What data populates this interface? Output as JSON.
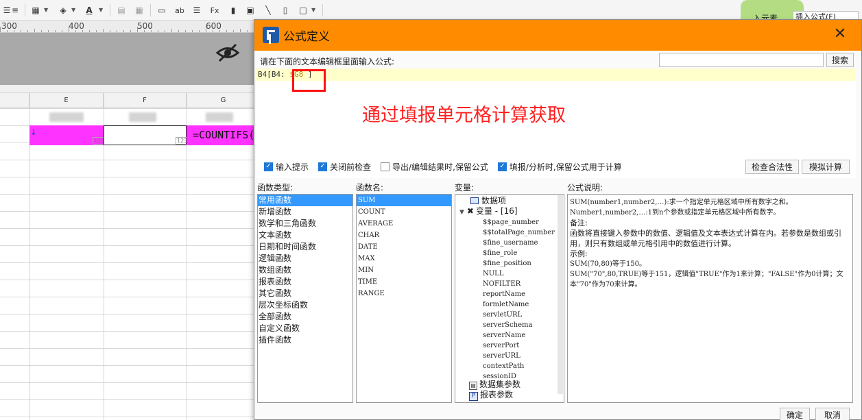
{
  "sheet": {
    "ruler_marks": [
      "300",
      "400",
      "500",
      "600"
    ],
    "columns": [
      "E",
      "F",
      "G"
    ],
    "cell_formula": "=COUNTIFS(",
    "cell_arrow": "↓",
    "cell_badge": "123"
  },
  "topbar": {
    "insert_element": "入元素",
    "insert_formula": "插入公式(F)"
  },
  "dialog": {
    "title": "公式定义",
    "close": "✕",
    "hint": "请在下面的文本编辑框里面输入公式:",
    "search_placeholder": "",
    "search_button": "搜索",
    "formula_prefix": "B4[B4: ",
    "formula_ref": "$G8",
    "formula_suffix": " ]",
    "annotation": "通过填报单元格计算获取",
    "options": [
      {
        "label": "输入提示",
        "checked": true
      },
      {
        "label": "关闭前检查",
        "checked": true
      },
      {
        "label": "导出/编辑结果时,保留公式",
        "checked": false
      },
      {
        "label": "填报/分析时,保留公式用于计算",
        "checked": true
      }
    ],
    "validate_button": "检查合法性",
    "simulate_button": "模拟计算",
    "function_type_label": "函数类型:",
    "function_name_label": "函数名:",
    "variable_label": "变量:",
    "description_label": "公式说明:",
    "function_types": [
      "常用函数",
      "新增函数",
      "数学和三角函数",
      "文本函数",
      "日期和时间函数",
      "逻辑函数",
      "数组函数",
      "报表函数",
      "其它函数",
      "层次坐标函数",
      "全部函数",
      "自定义函数",
      "插件函数"
    ],
    "function_names": [
      "SUM",
      "COUNT",
      "AVERAGE",
      "CHAR",
      "DATE",
      "MAX",
      "MIN",
      "TIME",
      "RANGE"
    ],
    "variables": {
      "data_items": "数据项",
      "variables_node": "变量 - [16]",
      "items": [
        "$$page_number",
        "$$totalPage_number",
        "$fine_username",
        "$fine_role",
        "$fine_position",
        "NULL",
        "NOFILTER",
        "reportName",
        "formletName",
        "servletURL",
        "serverSchema",
        "serverName",
        "serverPort",
        "serverURL",
        "contextPath",
        "sessionID"
      ],
      "dataset_params": "数据集参数",
      "report_params": "报表参数"
    },
    "description": {
      "line1": "SUM(number1,number2,…):求一个指定单元格区域中所有数字之和。",
      "line2": "Number1,number2,…:1到n个参数或指定单元格区域中所有数字。",
      "line3": "备注:",
      "line4": "函数将直接键入参数中的数值、逻辑值及文本表达式计算在内。若参数是数组或引用，则只有数组或单元格引用中的数值进行计算。",
      "line5": "示例:",
      "line6": "SUM(70,80)等于150。",
      "line7": "SUM(\"70\",80,TRUE)等于151，逻辑值\"TRUE\"作为1来计算；\"FALSE\"作为0计算；文本\"70\"作为70来计算。"
    },
    "ok_button": "确定",
    "cancel_button": "取消"
  }
}
